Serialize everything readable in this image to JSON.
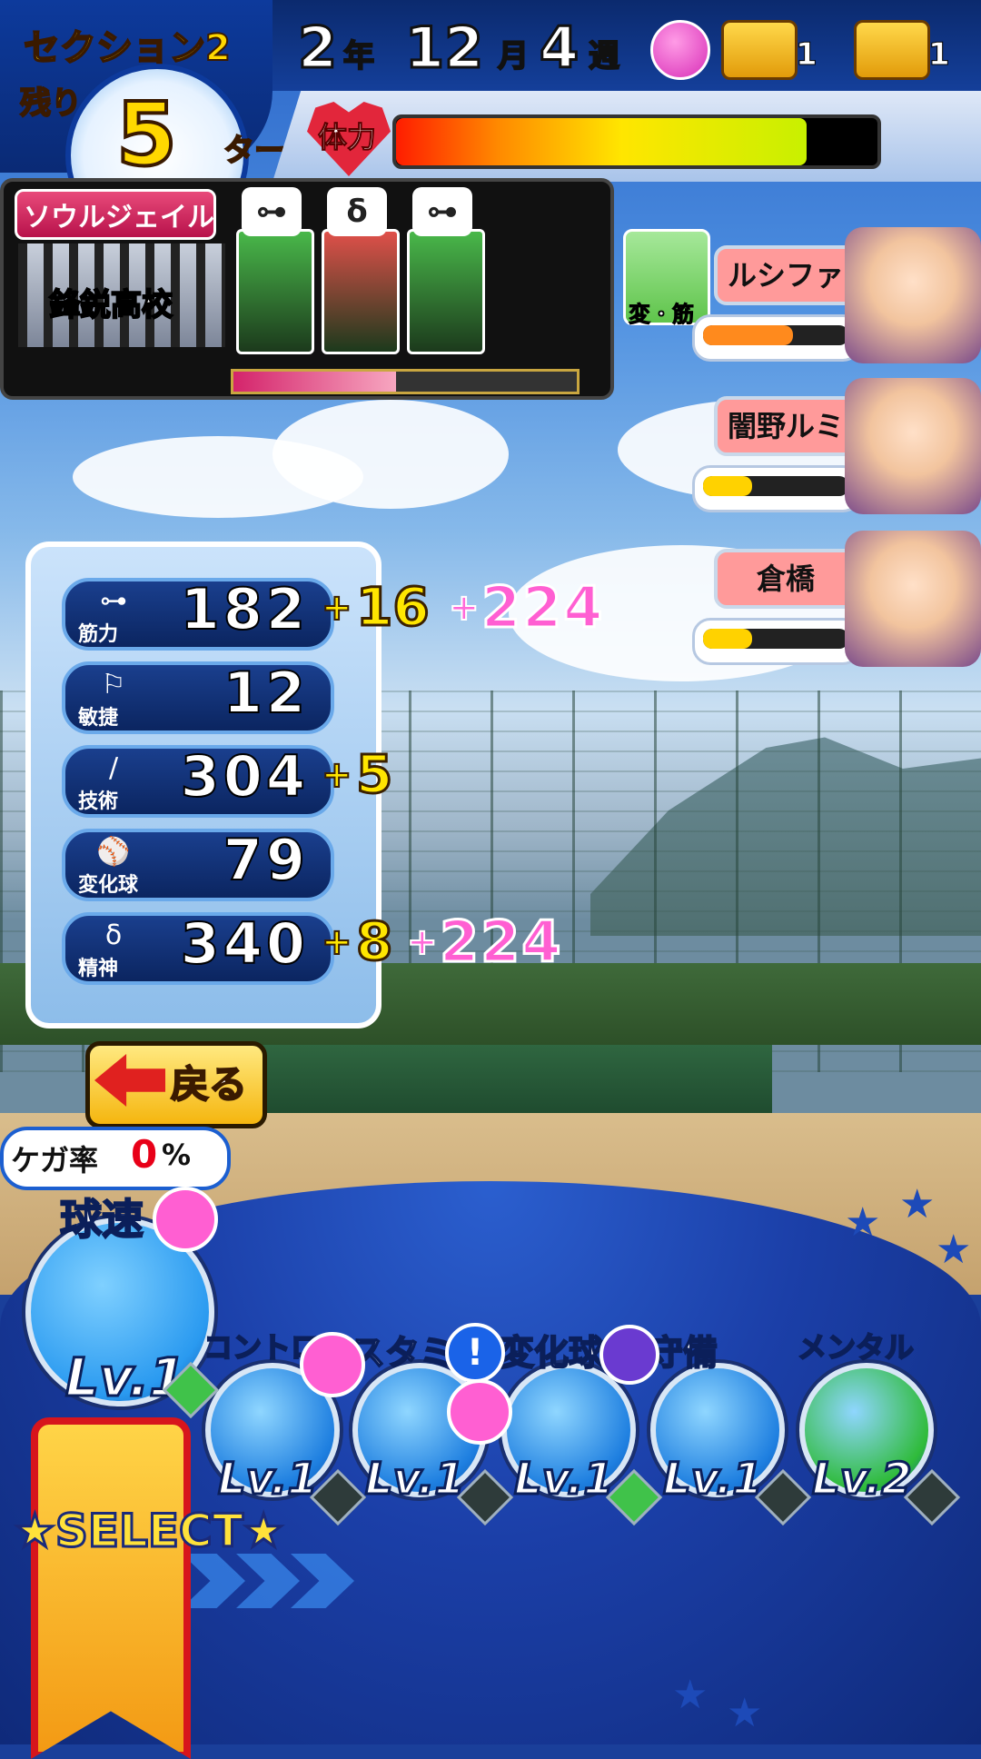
{
  "header": {
    "section_title": "セクション2",
    "remaining_label": "残り",
    "turns_remaining": "5",
    "turn_label": "ターン",
    "date": {
      "year": "2",
      "year_unit": "年",
      "month": "12",
      "month_unit": "月",
      "week": "4",
      "week_unit": "週"
    },
    "chests": [
      {
        "icon": "red-treasure-chest-icon",
        "count": "1"
      },
      {
        "icon": "gold-treasure-chest-icon",
        "count": "1"
      }
    ],
    "mood_icon": "happy-face-icon"
  },
  "stamina": {
    "label": "体力",
    "level": 0.86,
    "colors": [
      "#ff1d00",
      "#ffe600",
      "#c8f000"
    ]
  },
  "team": {
    "tag": "ソウルジェイル",
    "school_name": "鋒鋭高校",
    "members": [
      {
        "tag_icon": "dumbbell-icon",
        "tag_glyph": "⊶",
        "color": "#49b84a"
      },
      {
        "tag_icon": "spirit-icon",
        "tag_glyph": "δ",
        "color": "#e0504a"
      },
      {
        "tag_icon": "dumbbell-icon",
        "tag_glyph": "⊶",
        "color": "#49b84a"
      }
    ],
    "gauge_level": 0.48
  },
  "skill_tile": {
    "label": "変・筋",
    "icon": "change-strength-icon"
  },
  "characters": [
    {
      "name": "ルシファー",
      "gauge_level": 0.62,
      "gauge_color": "#ff8a1d",
      "name_bg": "#ff9a9a",
      "portrait": "lucifer-portrait"
    },
    {
      "name": "闇野ルミナ",
      "gauge_level": 0.34,
      "gauge_color": "#ffd200",
      "name_bg": "#ff9a9a",
      "portrait": "lumina-portrait"
    },
    {
      "name": "倉橋",
      "gauge_level": 0.34,
      "gauge_color": "#ffd200",
      "name_bg": "#ff9a9a",
      "portrait": "kurahashi-portrait"
    }
  ],
  "stats": [
    {
      "icon": "dumbbell-icon",
      "glyph": "⊶",
      "label": "筋力",
      "value": "182",
      "plus1": "+",
      "bonus": "16",
      "plus2": "+",
      "bonus2": "224"
    },
    {
      "icon": "spike-shoe-icon",
      "glyph": "⚐",
      "label": "敏捷",
      "value": "12",
      "plus1": "",
      "bonus": "",
      "plus2": "",
      "bonus2": ""
    },
    {
      "icon": "bat-icon",
      "glyph": "∕",
      "label": "技術",
      "value": "304",
      "plus1": "+",
      "bonus": "5",
      "plus2": "",
      "bonus2": ""
    },
    {
      "icon": "breaking-ball-icon",
      "glyph": "⚾",
      "label": "変化球",
      "value": "79",
      "plus1": "",
      "bonus": "",
      "plus2": "",
      "bonus2": ""
    },
    {
      "icon": "spirit-icon",
      "glyph": "δ",
      "label": "精神",
      "value": "340",
      "plus1": "+",
      "bonus": "8",
      "plus2": "+",
      "bonus2": "224"
    }
  ],
  "back_button": {
    "label": "戻る",
    "icon": "left-arrow-icon"
  },
  "injury": {
    "label": "ケガ率",
    "value": "0",
    "unit": "%"
  },
  "training": [
    {
      "title": "球速",
      "level": "Lv.1",
      "icon": "fastball-icon",
      "color": "#2a9af0"
    },
    {
      "title": "コントロー",
      "level": "Lv.1",
      "icon": "target-icon",
      "color": "#1e7fe0"
    },
    {
      "title": "スタミ",
      "level": "Lv.1",
      "icon": "tire-icon",
      "color": "#1e7fe0"
    },
    {
      "title": "変化球",
      "level": "Lv.1",
      "icon": "breaking-ball-arrows-icon",
      "color": "#1e7fe0"
    },
    {
      "title": "守備",
      "level": "Lv.1",
      "icon": "glove-icon",
      "color": "#1e7fe0"
    },
    {
      "title": "メンタル",
      "level": "Lv.2",
      "icon": "sparkle-cloud-icon",
      "color": "#2fbb3a"
    }
  ],
  "alert_glyph": "!",
  "select": {
    "label": "★SELECT★"
  }
}
